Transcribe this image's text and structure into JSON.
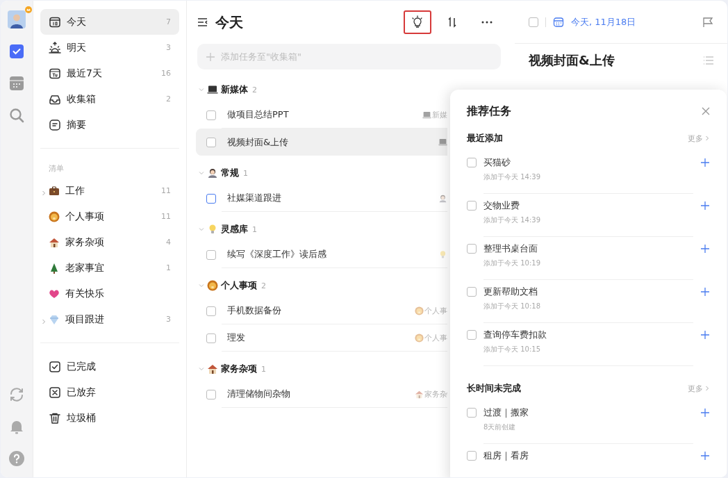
{
  "rail": [
    {
      "kind": "avatar",
      "badge": true
    },
    {
      "kind": "tasks",
      "selected": true
    },
    {
      "kind": "calendar",
      "selected": false
    },
    {
      "kind": "search",
      "selected": false
    }
  ],
  "rail_bottom": [
    {
      "kind": "sync"
    },
    {
      "kind": "bell"
    },
    {
      "kind": "help"
    }
  ],
  "sidebar": {
    "smart_lists": [
      {
        "kind": "today",
        "label": "今天",
        "count": "7",
        "selected": true
      },
      {
        "kind": "tomorrow",
        "label": "明天",
        "count": "3",
        "selected": false
      },
      {
        "kind": "week",
        "label": "最近7天",
        "count": "16",
        "selected": false
      },
      {
        "kind": "inbox",
        "label": "收集箱",
        "count": "2",
        "selected": false
      },
      {
        "kind": "summary",
        "label": "摘要",
        "selected": false
      }
    ],
    "section_title": "清单",
    "lists": [
      {
        "kind": "briefcase",
        "label": "工作",
        "count": "11",
        "has_children": true,
        "selected": false
      },
      {
        "kind": "lion",
        "label": "个人事项",
        "count": "11",
        "has_children": false,
        "selected": false
      },
      {
        "kind": "house",
        "label": "家务杂项",
        "count": "4",
        "has_children": false,
        "selected": false
      },
      {
        "kind": "tree",
        "label": "老家事宜",
        "count": "1",
        "has_children": false,
        "selected": false
      },
      {
        "kind": "heart",
        "label": "有关快乐",
        "has_children": false,
        "selected": false
      },
      {
        "kind": "gem",
        "label": "项目跟进",
        "count": "3",
        "has_children": true,
        "selected": false
      }
    ],
    "archive": [
      {
        "kind": "done",
        "label": "已完成",
        "selected": false
      },
      {
        "kind": "abandoned",
        "label": "已放弃",
        "selected": false
      },
      {
        "kind": "trash",
        "label": "垃圾桶",
        "selected": false
      }
    ]
  },
  "main": {
    "title": "今天",
    "add_placeholder": "添加任务至\"收集箱\"",
    "groups": [
      {
        "kind": "laptop",
        "name": "新媒体",
        "count": "2",
        "expanded": true,
        "tasks": [
          {
            "title": "做项目总结PPT",
            "tag": "新媒",
            "selected": false,
            "color": "#bdbdbd"
          },
          {
            "title": "视频封面&上传",
            "selected": true,
            "color": "#bdbdbd"
          }
        ]
      },
      {
        "kind": "person",
        "name": "常规",
        "count": "1",
        "expanded": true,
        "tasks": [
          {
            "title": "社媒渠道跟进",
            "selected": false,
            "color": "#4a7cf0"
          }
        ]
      },
      {
        "kind": "bulb",
        "name": "灵感库",
        "count": "1",
        "expanded": true,
        "tasks": [
          {
            "title": "续写《深度工作》读后感",
            "selected": false,
            "color": "#bdbdbd"
          }
        ]
      },
      {
        "kind": "lion",
        "name": "个人事项",
        "count": "2",
        "expanded": true,
        "tasks": [
          {
            "title": "手机数据备份",
            "tag": "个人事",
            "selected": false,
            "color": "#bdbdbd"
          },
          {
            "title": "理发",
            "tag": "个人事",
            "selected": false,
            "color": "#bdbdbd"
          }
        ]
      },
      {
        "kind": "house",
        "name": "家务杂项",
        "count": "1",
        "expanded": true,
        "tasks": [
          {
            "title": "清理储物间杂物",
            "tag": "家务杂",
            "selected": false,
            "color": "#bdbdbd"
          }
        ]
      }
    ]
  },
  "detail": {
    "checked": false,
    "date": "今天, 11月18日",
    "title": "视频封面&上传"
  },
  "popup": {
    "title": "推荐任务",
    "sections": [
      {
        "title": "最近添加",
        "more": "更多",
        "items": [
          {
            "title": "买猫砂",
            "meta": "添加于今天 14:39",
            "checked": false
          },
          {
            "title": "交物业费",
            "meta": "添加于今天 14:39",
            "checked": false
          },
          {
            "title": "整理书桌台面",
            "meta": "添加于今天 10:19",
            "checked": false
          },
          {
            "title": "更新帮助文档",
            "meta": "添加于今天 10:18",
            "checked": false
          },
          {
            "title": "查询停车费扣款",
            "meta": "添加于今天 10:15",
            "checked": false
          }
        ]
      },
      {
        "title": "长时间未完成",
        "more": "更多",
        "items": [
          {
            "title": "过渡｜搬家",
            "meta": "8天前创建",
            "checked": false
          },
          {
            "title": "租房｜看房",
            "checked": false
          }
        ]
      }
    ]
  }
}
